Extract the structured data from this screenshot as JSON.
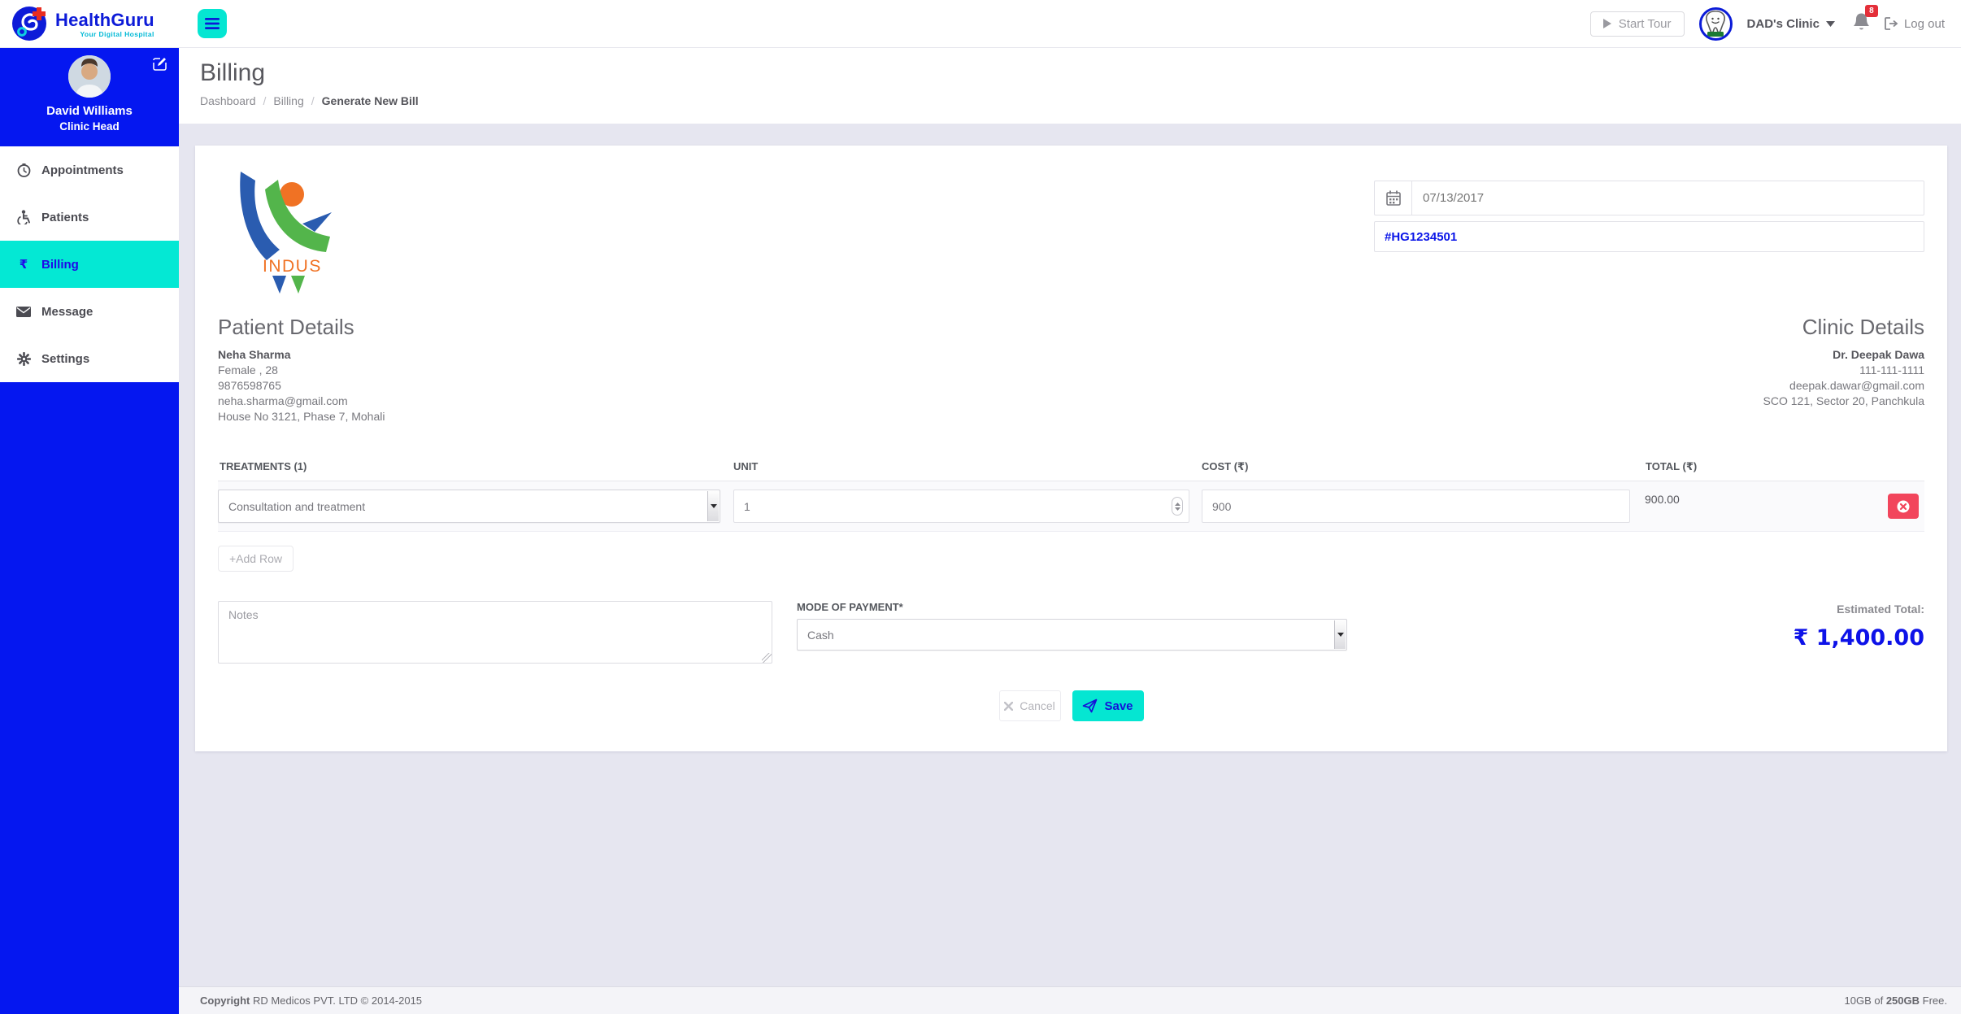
{
  "topbar": {
    "brand": {
      "name": "HealthGuru",
      "tagline": "Your Digital Hospital"
    },
    "start_tour_label": "Start Tour",
    "clinic_name": "DAD's Clinic",
    "notification_count": "8",
    "logout_label": "Log out"
  },
  "sidebar": {
    "profile": {
      "name": "David Williams",
      "role": "Clinic Head"
    },
    "items": [
      {
        "label": "Appointments",
        "icon": "clock-icon"
      },
      {
        "label": "Patients",
        "icon": "wheelchair-icon"
      },
      {
        "label": "Billing",
        "icon": "rupee-icon",
        "active": true
      },
      {
        "label": "Message",
        "icon": "envelope-icon"
      },
      {
        "label": "Settings",
        "icon": "gear-icon"
      }
    ],
    "rupee_glyph": "₹"
  },
  "page": {
    "title": "Billing",
    "breadcrumb": [
      "Dashboard",
      "Billing",
      "Generate New Bill"
    ],
    "breadcrumb_separator": "/"
  },
  "bill": {
    "practice_logo_text": "INDUS",
    "date": "07/13/2017",
    "invoice_number": "#HG1234501",
    "patient": {
      "heading": "Patient Details",
      "name": "Neha Sharma",
      "gender_age": "Female , 28",
      "phone": "9876598765",
      "email": "neha.sharma@gmail.com",
      "address": "House No 3121, Phase 7, Mohali"
    },
    "clinic": {
      "heading": "Clinic Details",
      "doctor": "Dr. Deepak Dawa",
      "phone": "111-111-1111",
      "email": "deepak.dawar@gmail.com",
      "address": "SCO 121, Sector 20, Panchkula"
    },
    "treatments": {
      "headers": {
        "treatment": "TREATMENTS (1)",
        "unit": "UNIT",
        "cost": "COST (₹)",
        "total": "TOTAL (₹)"
      },
      "rows": [
        {
          "treatment": "Consultation and treatment",
          "unit": "1",
          "cost": "900",
          "total": "900.00"
        }
      ],
      "add_row_label": "+Add Row"
    },
    "notes_placeholder": "Notes",
    "payment": {
      "label": "MODE OF PAYMENT*",
      "selected": "Cash"
    },
    "estimated_total_label": "Estimated Total:",
    "estimated_total_value": "₹ 1,400.00",
    "cancel_label": "Cancel",
    "save_label": "Save"
  },
  "footer": {
    "copyright_bold": "Copyright",
    "copyright_rest": " RD Medicos PVT. LTD © 2014-2015",
    "storage_prefix": "10GB of ",
    "storage_bold": "250GB",
    "storage_suffix": " Free."
  },
  "colors": {
    "sidebar_blue": "#0517f0",
    "accent_teal": "#05e6d2",
    "link_blue": "#0b16e8",
    "danger_red": "#f2455c",
    "badge_red": "#e42f39",
    "content_bg": "#e6e6f0"
  }
}
